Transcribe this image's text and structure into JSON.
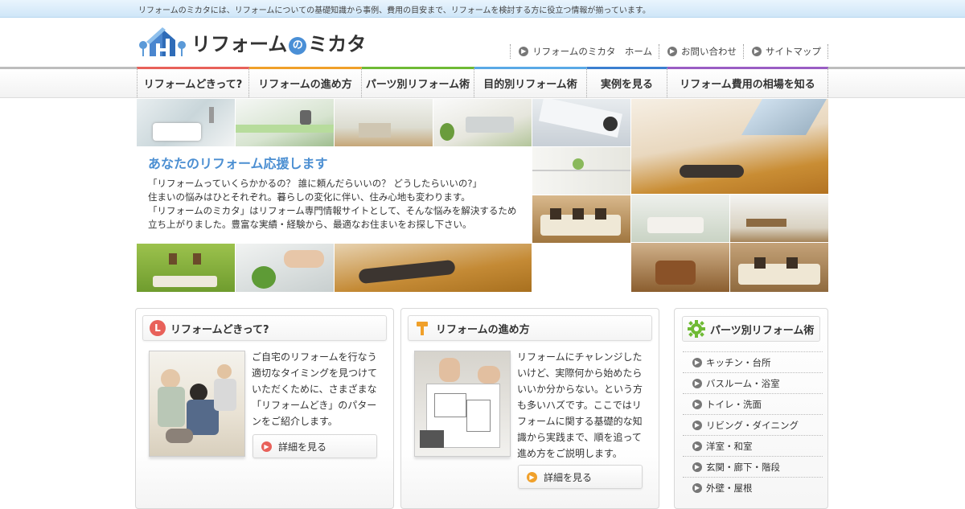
{
  "topbar": {
    "tagline": "リフォームのミカタには、リフォームについての基礎知識から事例、費用の目安まで、リフォームを検討する方に役立つ情報が揃っています。"
  },
  "logo": {
    "pre": "リフォーム",
    "no": "の",
    "post": "ミカタ"
  },
  "util_links": [
    {
      "label": "リフォームのミカタ　ホーム"
    },
    {
      "label": "お問い合わせ"
    },
    {
      "label": "サイトマップ"
    }
  ],
  "nav": [
    {
      "label": "リフォームどきって?",
      "color": "#e8615a"
    },
    {
      "label": "リフォームの進め方",
      "color": "#f0a02a"
    },
    {
      "label": "パーツ別リフォーム術",
      "color": "#6fba34"
    },
    {
      "label": "目的別リフォーム術",
      "color": "#5aa9e6"
    },
    {
      "label": "実例を見る",
      "color": "#3b7fd0"
    },
    {
      "label": "リフォーム費用の相場を知る",
      "color": "#9a5dc4"
    }
  ],
  "hero": {
    "title": "あなたのリフォーム応援します",
    "lines": [
      "「リフォームっていくらかかるの？ 誰に頼んだらいいの？ どうしたらいいの?」",
      "住まいの悩みはひとそれぞれ。暮らしの変化に伴い、住み心地も変わります。",
      "「リフォームのミカタ」はリフォーム専門情報サイトとして、そんな悩みを解決するため",
      "立ち上がりました。豊富な実績・経験から、最適なお住まいをお探し下さい。"
    ]
  },
  "cards": [
    {
      "title": "リフォームどきって?",
      "icon_letter": "L",
      "icon_color": "#e8615a",
      "lines": [
        "ご自宅のリフォームを行なう",
        "適切なタイミングを見つけて",
        "いただくために、さまざまな",
        "「リフォームどき」のパター",
        "ンをご紹介します。"
      ],
      "button": "詳細を見る",
      "button_color": "#e8615a"
    },
    {
      "title": "リフォームの進め方",
      "icon_color": "#f0a02a",
      "lines": [
        "リフォームにチャレンジした",
        "いけど、実際何から始めたら",
        "いいか分からない。という方",
        "も多いハズです。ここではリ",
        "フォームに関する基礎的な知",
        "識から実践まで、順を追って",
        "進め方をご説明します。"
      ],
      "button": "詳細を見る",
      "button_color": "#f0a02a"
    }
  ],
  "sidebar": {
    "title": "パーツ別リフォーム術",
    "icon_color": "#6fba34",
    "items": [
      {
        "label": "キッチン・台所"
      },
      {
        "label": "バスルーム・浴室"
      },
      {
        "label": "トイレ・洗面"
      },
      {
        "label": "リビング・ダイニング"
      },
      {
        "label": "洋室・和室"
      },
      {
        "label": "玄関・廊下・階段"
      },
      {
        "label": "外壁・屋根"
      }
    ]
  }
}
